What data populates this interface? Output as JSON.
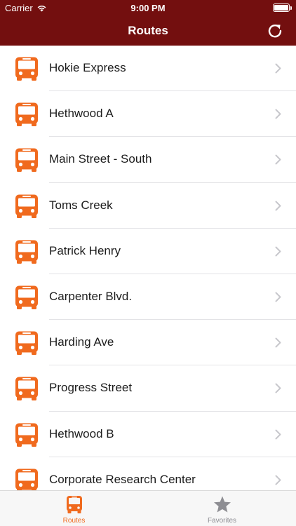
{
  "status_bar": {
    "carrier": "Carrier",
    "time": "9:00 PM"
  },
  "header": {
    "title": "Routes",
    "background_color": "#730f0f",
    "refresh_icon": "refresh-icon"
  },
  "colors": {
    "accent": "#f06a1e",
    "inactive": "#8e8e93"
  },
  "routes": [
    {
      "label": "Hokie Express",
      "icon": "bus-icon"
    },
    {
      "label": "Hethwood A",
      "icon": "bus-icon"
    },
    {
      "label": "Main Street - South",
      "icon": "bus-icon"
    },
    {
      "label": "Toms Creek",
      "icon": "bus-icon"
    },
    {
      "label": "Patrick Henry",
      "icon": "bus-icon"
    },
    {
      "label": "Carpenter Blvd.",
      "icon": "bus-icon"
    },
    {
      "label": "Harding Ave",
      "icon": "bus-icon"
    },
    {
      "label": "Progress Street",
      "icon": "bus-icon"
    },
    {
      "label": "Hethwood B",
      "icon": "bus-icon"
    },
    {
      "label": "Corporate Research Center",
      "icon": "bus-icon"
    }
  ],
  "tab_bar": {
    "tabs": [
      {
        "label": "Routes",
        "icon": "bus-icon",
        "selected": true
      },
      {
        "label": "Favorites",
        "icon": "star-icon",
        "selected": false
      }
    ]
  }
}
